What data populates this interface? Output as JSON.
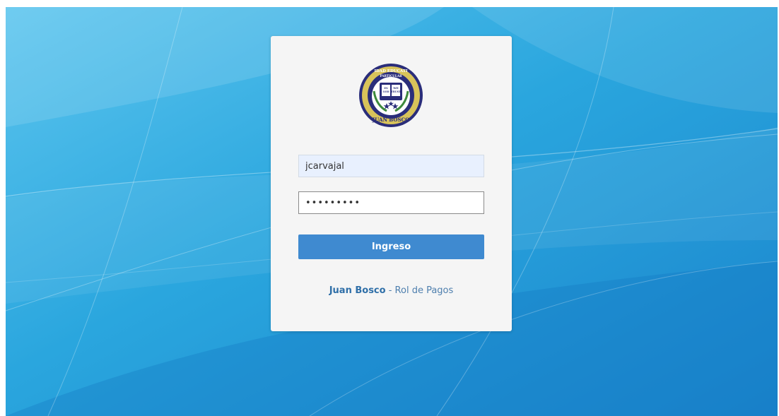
{
  "login": {
    "username_value": "jcarvajal",
    "password_value": "jcarvajal",
    "submit_label": "Ingreso"
  },
  "logo": {
    "top_text": "IDAD EDUCATI",
    "sub_text": "PARTICULAR",
    "book_left": "IN",
    "book_left2": "GOD",
    "book_right": "WE",
    "book_right2": "TRUST",
    "bottom_text": "JUAN BOSCO"
  },
  "footer": {
    "brand": "Juan Bosco",
    "separator": " - ",
    "tagline": "Rol de Pagos"
  },
  "colors": {
    "background": "#2aa6de",
    "card": "#f5f5f5",
    "button": "#3f8ad0",
    "link": "#2f6fa8"
  }
}
